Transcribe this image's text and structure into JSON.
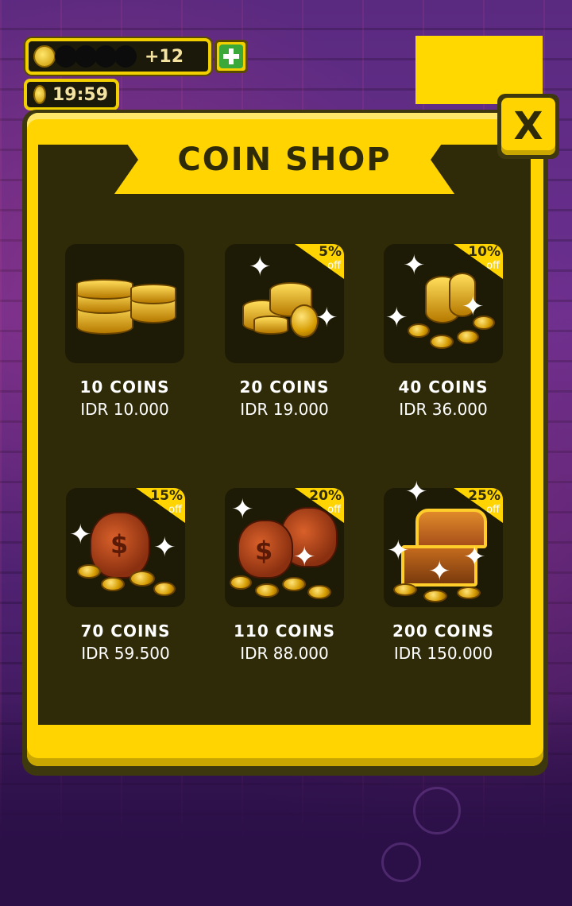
{
  "hud": {
    "coin_delta": "+12",
    "timer": "19:59"
  },
  "shop": {
    "title": "COIN SHOP",
    "close_label": "X",
    "items": [
      {
        "name": "10 COINS",
        "price": "IDR 10.000",
        "discount": "",
        "discount_off": ""
      },
      {
        "name": "20 COINS",
        "price": "IDR 19.000",
        "discount": "5%",
        "discount_off": "off"
      },
      {
        "name": "40 COINS",
        "price": "IDR 36.000",
        "discount": "10%",
        "discount_off": "off"
      },
      {
        "name": "70 COINS",
        "price": "IDR 59.500",
        "discount": "15%",
        "discount_off": "off"
      },
      {
        "name": "110 COINS",
        "price": "IDR 88.000",
        "discount": "20%",
        "discount_off": "off"
      },
      {
        "name": "200 COINS",
        "price": "IDR 150.000",
        "discount": "25%",
        "discount_off": "off"
      }
    ]
  },
  "icons": {
    "hud_coin": "coin-icon",
    "add": "plus-icon",
    "timer": "coin-timer-icon",
    "close": "close-icon",
    "items": [
      "coin-stack-icon",
      "coin-pile-icon",
      "coin-heap-icon",
      "money-bag-icon",
      "money-bags-icon",
      "treasure-chest-icon"
    ]
  },
  "colors": {
    "accent": "#ffd400",
    "panel": "#2f2b08",
    "add_button": "#3aa93a"
  }
}
